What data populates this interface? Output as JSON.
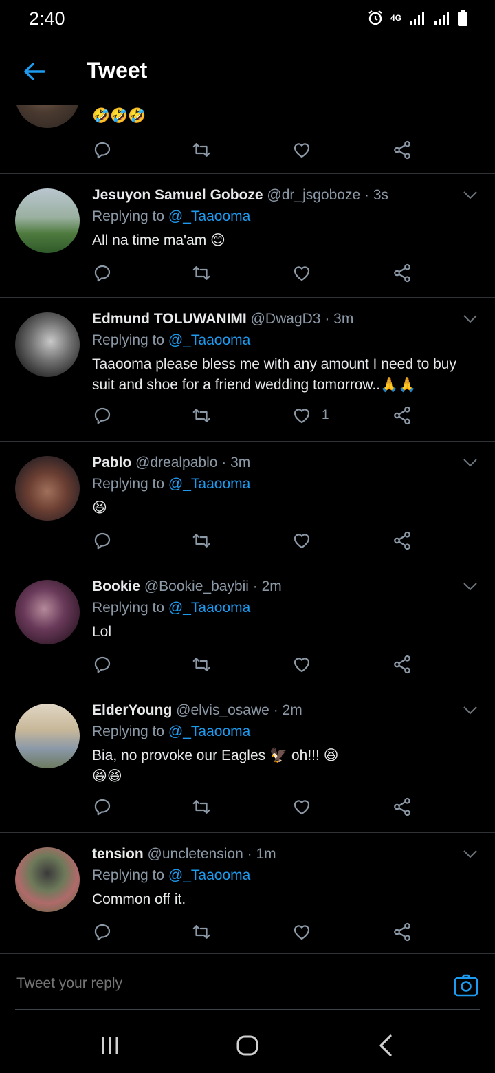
{
  "status_bar": {
    "time": "2:40",
    "network": "4G"
  },
  "header": {
    "title": "Tweet"
  },
  "partial_tweet": {
    "text": "🤣🤣🤣"
  },
  "tweets": [
    {
      "name": "Jesuyon Samuel Goboze",
      "handle": "@dr_jsgoboze",
      "dot": "·",
      "time": "3s",
      "replying_prefix": "Replying to",
      "replying_to": "@_Taaooma",
      "text": "All na time ma'am 😊",
      "likes": ""
    },
    {
      "name": "Edmund TOLUWANIMI",
      "handle": "@DwagD3",
      "dot": "·",
      "time": "3m",
      "replying_prefix": "Replying to",
      "replying_to": "@_Taaooma",
      "text": "Taaooma please bless me with any amount I need to buy suit and shoe for a friend wedding tomorrow..🙏🙏",
      "likes": "1"
    },
    {
      "name": "Pablo",
      "handle": "@drealpablo",
      "dot": "·",
      "time": "3m",
      "replying_prefix": "Replying to",
      "replying_to": "@_Taaooma",
      "text": "😆",
      "likes": ""
    },
    {
      "name": "Bookie",
      "handle": "@Bookie_baybii",
      "dot": "·",
      "time": "2m",
      "replying_prefix": "Replying to",
      "replying_to": "@_Taaooma",
      "text": "Lol",
      "likes": ""
    },
    {
      "name": "ElderYoung",
      "handle": "@elvis_osawe",
      "dot": "·",
      "time": "2m",
      "replying_prefix": "Replying to",
      "replying_to": "@_Taaooma",
      "text": "Bia, no provoke our Eagles 🦅 oh!!! 😆😆😆",
      "likes": ""
    },
    {
      "name": "tension",
      "handle": "@uncletension",
      "dot": "·",
      "time": "1m",
      "replying_prefix": "Replying to",
      "replying_to": "@_Taaooma",
      "text": "Common off it.",
      "likes": ""
    }
  ],
  "reply_bar": {
    "placeholder": "Tweet your reply"
  },
  "colors": {
    "accent": "#1d9bf0",
    "background": "#000000",
    "muted": "#8b98a5",
    "divider": "#2f3336"
  },
  "icons": [
    "back-arrow-icon",
    "reply-icon",
    "retweet-icon",
    "like-icon",
    "share-icon",
    "camera-icon",
    "chevron-down-icon",
    "alarm-icon",
    "signal-icon",
    "battery-icon"
  ]
}
